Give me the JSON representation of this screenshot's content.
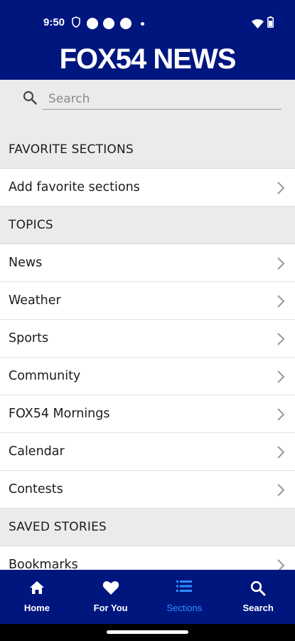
{
  "status_bar": {
    "time": "9:50"
  },
  "header": {
    "brand": "FOX54 NEWS"
  },
  "search": {
    "placeholder": "Search"
  },
  "favorites": {
    "heading": "FAVORITE SECTIONS",
    "items": [
      {
        "label": "Add favorite sections"
      }
    ]
  },
  "topics": {
    "heading": "TOPICS",
    "items": [
      {
        "label": "News"
      },
      {
        "label": "Weather"
      },
      {
        "label": "Sports"
      },
      {
        "label": "Community"
      },
      {
        "label": "FOX54 Mornings"
      },
      {
        "label": "Calendar"
      },
      {
        "label": "Contests"
      }
    ]
  },
  "saved": {
    "heading": "SAVED STORIES",
    "items": [
      {
        "label": "Bookmarks"
      }
    ]
  },
  "bottom_nav": {
    "items": [
      {
        "label": "Home",
        "icon": "home-icon"
      },
      {
        "label": "For You",
        "icon": "heart-icon"
      },
      {
        "label": "Sections",
        "icon": "list-icon",
        "active": true
      },
      {
        "label": "Search",
        "icon": "search-icon"
      }
    ]
  },
  "colors": {
    "brand_blue": "#00167f",
    "active_nav": "#2f8dff",
    "section_bg": "#ebebeb"
  }
}
